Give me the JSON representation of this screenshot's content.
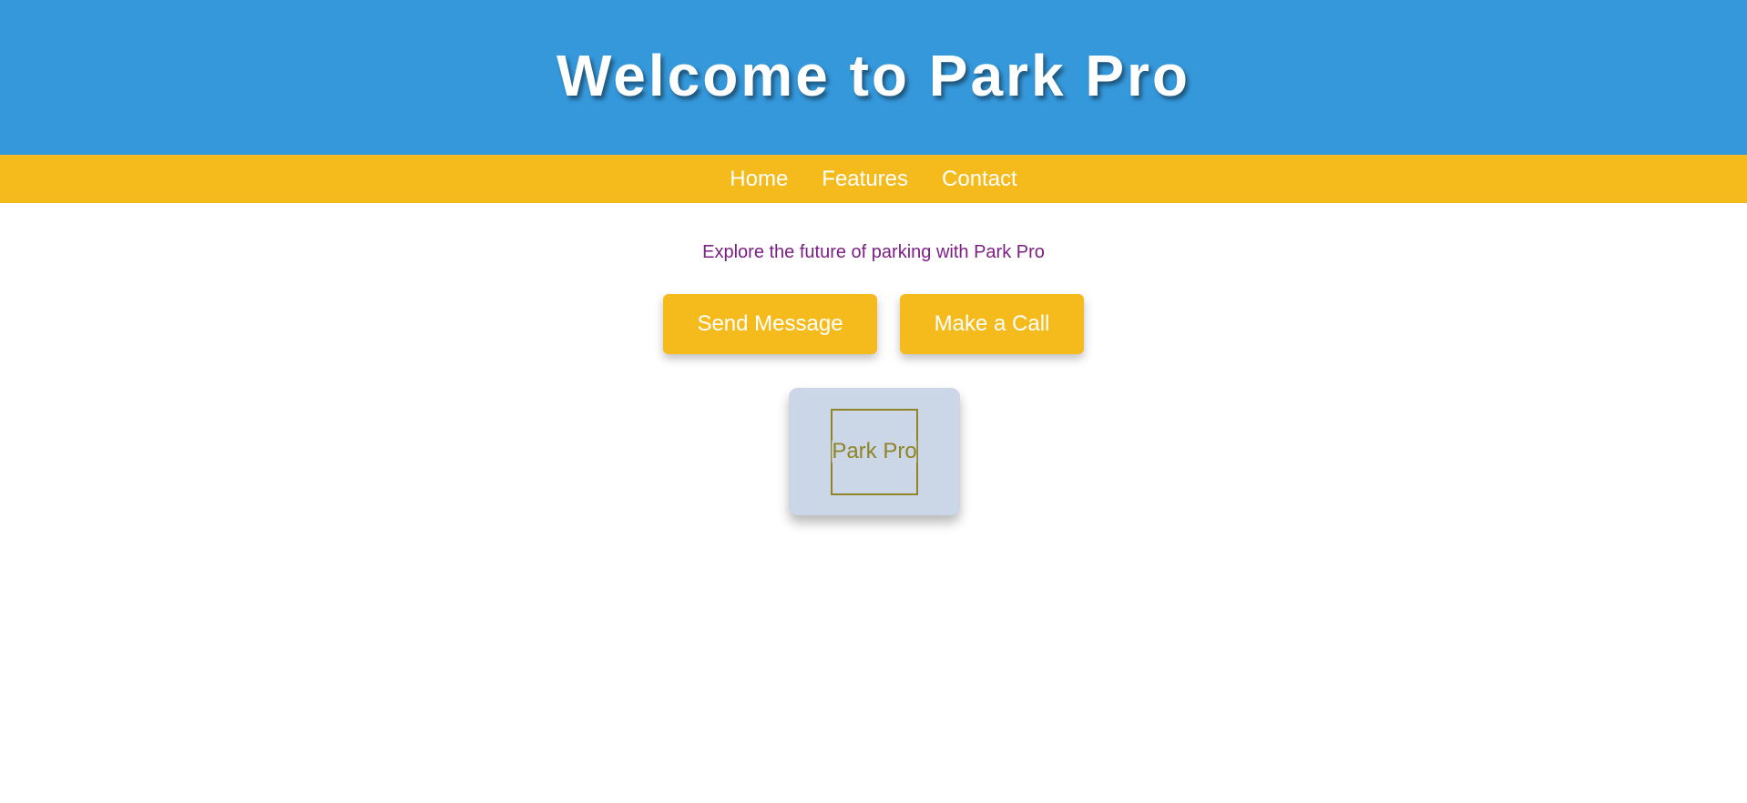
{
  "header": {
    "title": "Welcome to Park Pro"
  },
  "nav": {
    "items": [
      {
        "label": "Home"
      },
      {
        "label": "Features"
      },
      {
        "label": "Contact"
      }
    ]
  },
  "main": {
    "tagline": "Explore the future of parking with Park Pro",
    "buttons": {
      "send_message": "Send Message",
      "make_call": "Make a Call"
    },
    "logo": {
      "text": "Park Pro"
    }
  },
  "colors": {
    "header_bg": "#3598db",
    "nav_bg": "#f5ba1c",
    "button_bg": "#f5ba1c",
    "tagline": "#7b1f84",
    "logo_card_bg": "#cbd7e6",
    "logo_mark": "#8f8528"
  }
}
